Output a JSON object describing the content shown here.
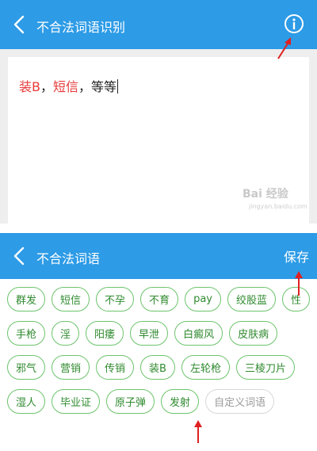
{
  "screen_top": {
    "title": "不合法词语识别",
    "back_icon": "chevron-left-icon",
    "info_icon": "info-icon"
  },
  "editor": {
    "kw1": "装B",
    "sep1": "，",
    "kw2": "短信",
    "sep2": "，",
    "rest": "等等"
  },
  "watermark": {
    "text": "Bai 经验",
    "sub": "jingyan.baidu.com"
  },
  "screen_bottom": {
    "title": "不合法词语",
    "save_label": "保存",
    "back_icon": "chevron-left-icon"
  },
  "words": [
    "群发",
    "短信",
    "不孕",
    "不育",
    "pay",
    "绞股蓝",
    "性",
    "手枪",
    "淫",
    "阳痿",
    "早泄",
    "白癜风",
    "皮肤病",
    "邪气",
    "营销",
    "传销",
    "装B",
    "左轮枪",
    "三棱刀片",
    "湿人",
    "毕业证",
    "原子弹",
    "发射"
  ],
  "custom_placeholder": "自定义词语",
  "colors": {
    "appbar": "#2d9be6",
    "chip_border": "#6cc46c",
    "chip_text": "#2f8a2f",
    "keyword": "#e83a3a",
    "annotation_arrow": "#e02020"
  }
}
